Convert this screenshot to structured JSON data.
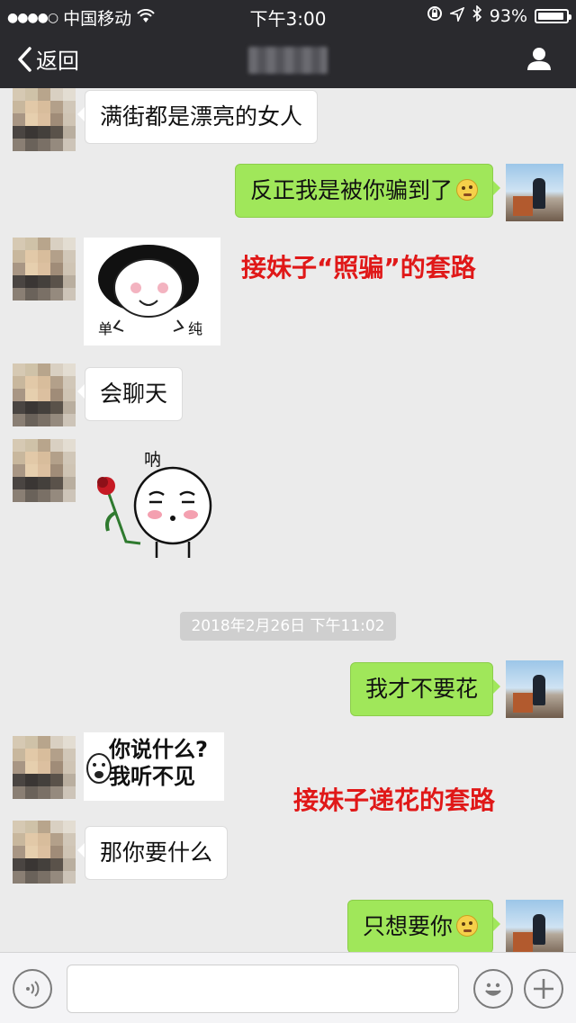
{
  "status_bar": {
    "signal": "●●●●○",
    "carrier": "中国移动",
    "time": "下午3:00",
    "battery": "93%"
  },
  "nav": {
    "back_label": "返回"
  },
  "messages": [
    {
      "side": "recv",
      "text": "满街都是漂亮的女人"
    },
    {
      "side": "sent",
      "text": "反正我是被你骗到了"
    },
    {
      "side": "recv",
      "type": "sticker",
      "text_left": "单",
      "text_right": "纯"
    },
    {
      "side": "recv",
      "text": "会聊天"
    },
    {
      "side": "recv",
      "type": "sticker",
      "text_top": "呐"
    },
    {
      "side": "sent",
      "text": "我才不要花"
    },
    {
      "side": "recv",
      "type": "sticker",
      "text": "你说什么?\n我听不见"
    },
    {
      "side": "recv",
      "text": "那你要什么"
    },
    {
      "side": "sent",
      "text": "只想要你"
    }
  ],
  "captions": {
    "first": "接妹子“照骗”的套路",
    "second": "接妹子递花的套路"
  },
  "timestamp": "2018年2月26日 下午11:02",
  "input_bar": {
    "placeholder": ""
  },
  "colors": {
    "bar_bg": "#2a2a2e",
    "chat_bg": "#ebebeb",
    "sent_bubble": "#a0e75a",
    "caption_red": "#e01818"
  }
}
